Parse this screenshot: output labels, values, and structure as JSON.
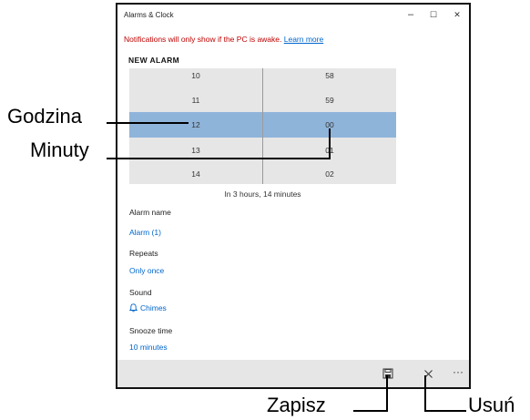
{
  "window": {
    "title": "Alarms & Clock",
    "controls": {
      "minimize": "–",
      "maximize": "☐",
      "close": "✕"
    }
  },
  "notice": {
    "text": "Notifications will only show if the PC is awake.",
    "link": "Learn more"
  },
  "heading": "NEW ALARM",
  "picker": {
    "hours": [
      "10",
      "11",
      "12",
      "13",
      "14"
    ],
    "minutes": [
      "58",
      "59",
      "00",
      "01",
      "02"
    ],
    "selected_hour": "12",
    "selected_minute": "00",
    "selection_color": "#8fb4da"
  },
  "summary": "In 3 hours, 14 minutes",
  "fields": {
    "alarm_name": {
      "label": "Alarm name",
      "value": "Alarm (1)"
    },
    "repeats": {
      "label": "Repeats",
      "value": "Only once"
    },
    "sound": {
      "label": "Sound",
      "value": "Chimes",
      "icon": "bell-icon"
    },
    "snooze": {
      "label": "Snooze time",
      "value": "10 minutes"
    }
  },
  "toolbar": {
    "save_icon": "save-icon",
    "delete_icon": "delete-icon",
    "more": "···"
  },
  "callouts": {
    "hour": "Godzina",
    "minutes": "Minuty",
    "save": "Zapisz",
    "delete": "Usuń"
  },
  "colors": {
    "accent": "#0066cc",
    "warning": "#c00000",
    "toolbar_bg": "#e6e6e6"
  }
}
